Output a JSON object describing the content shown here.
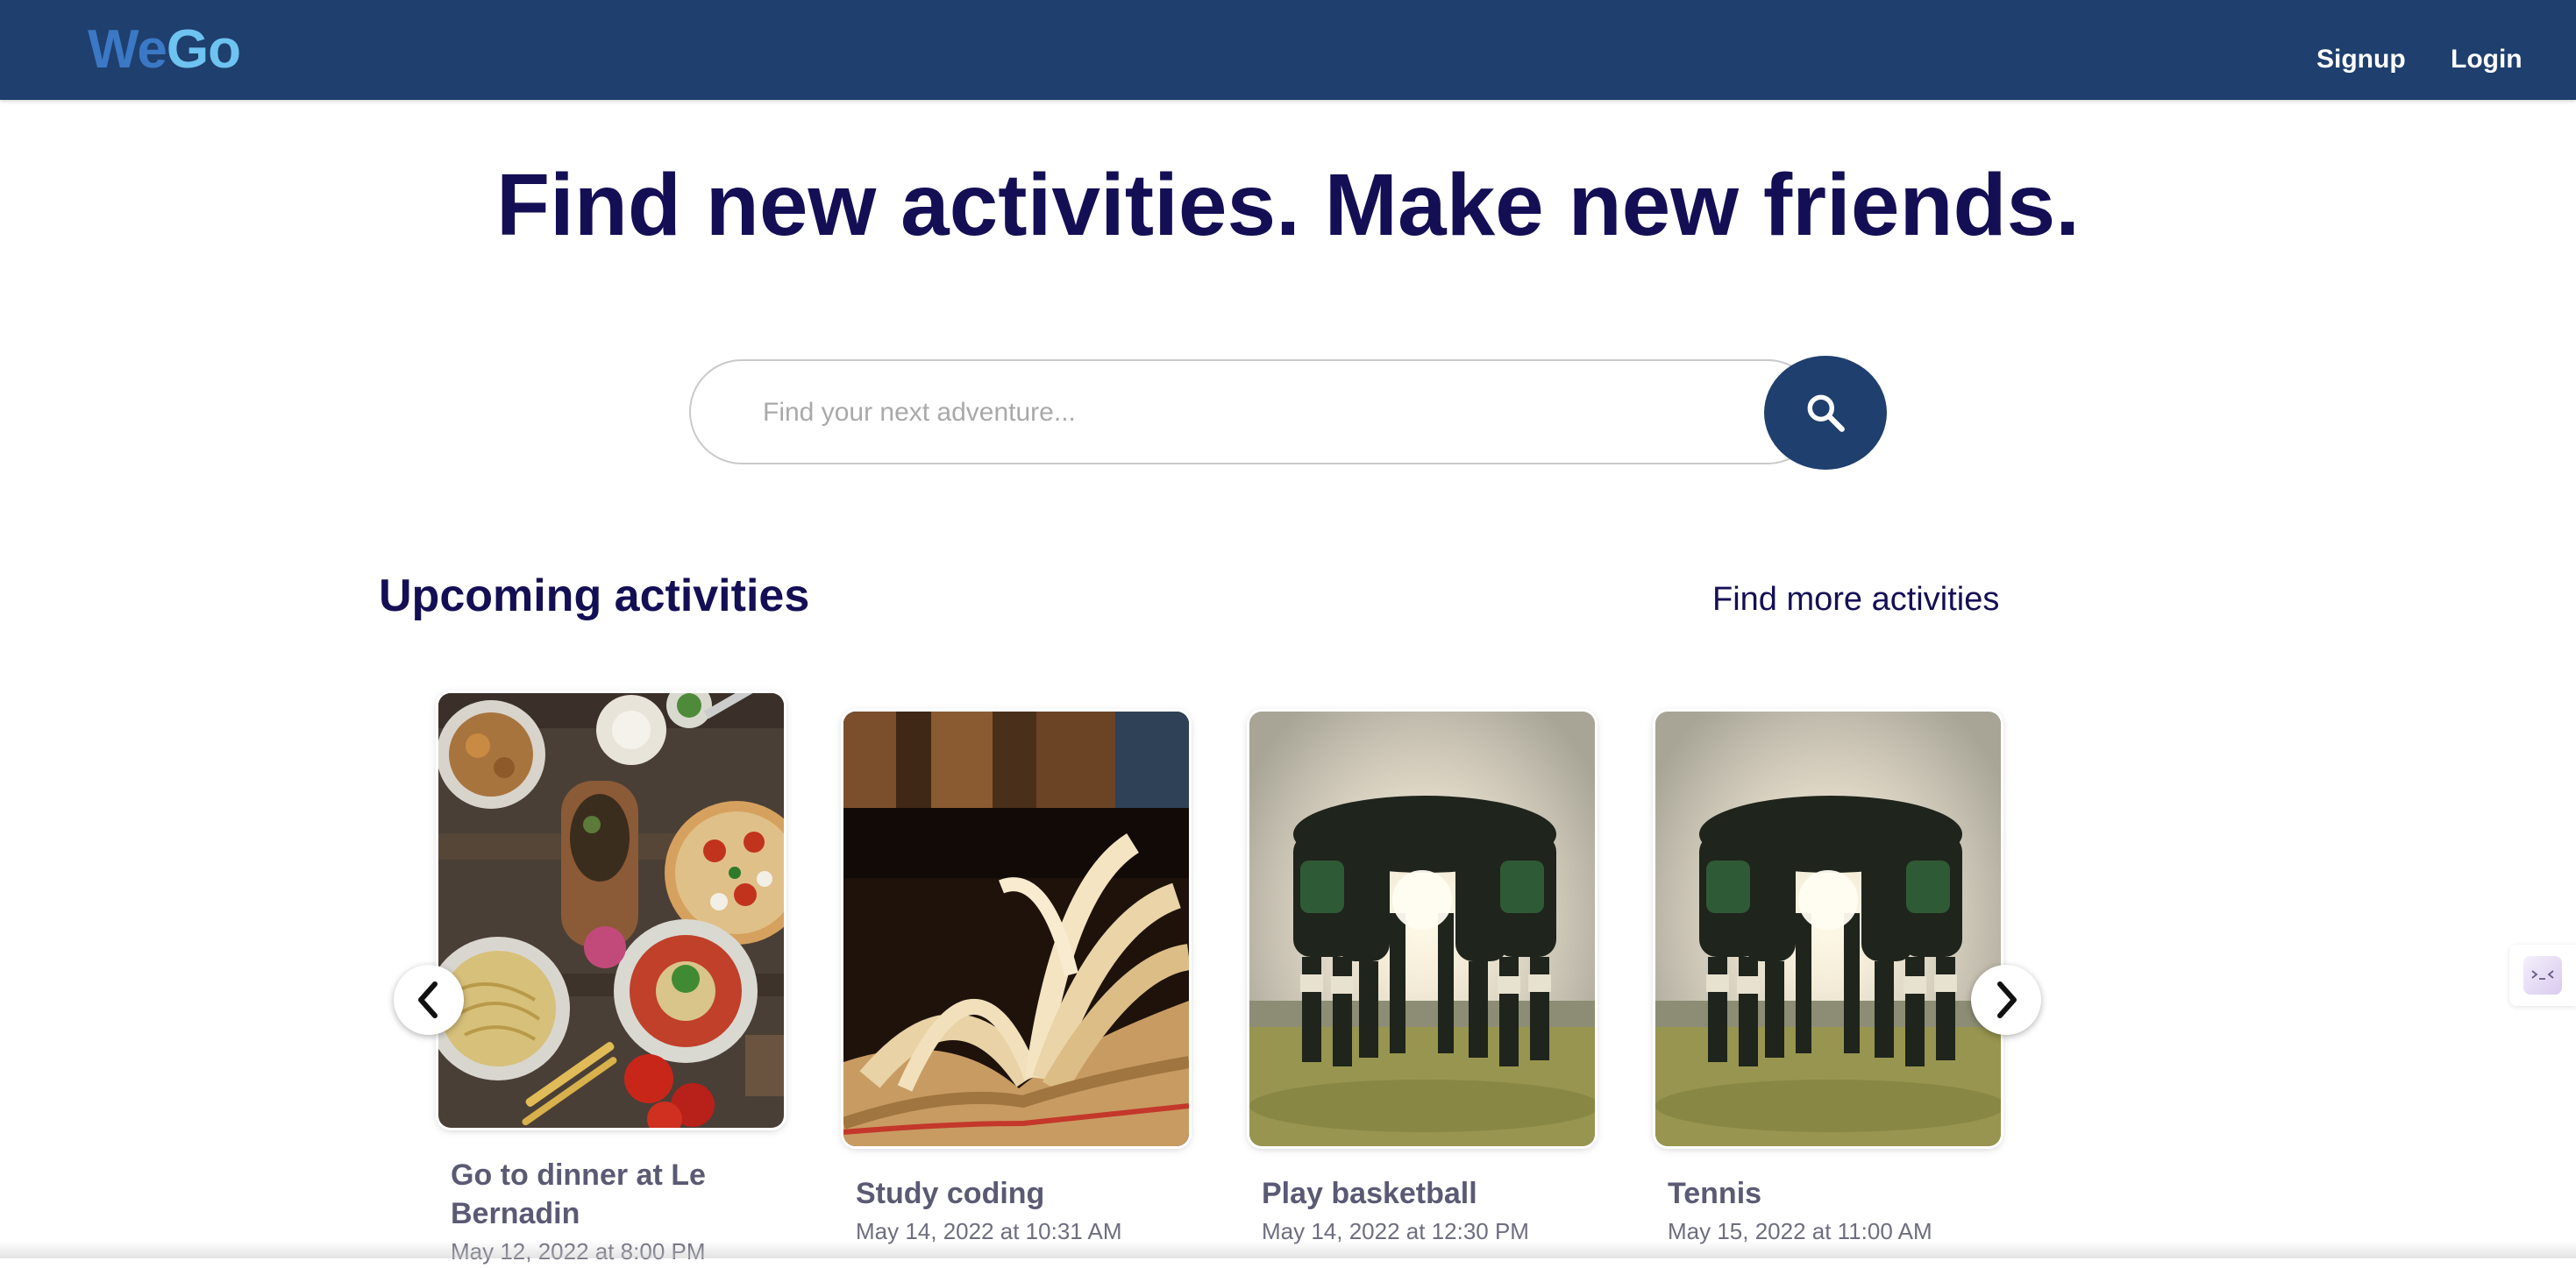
{
  "navbar": {
    "logo_part1": "We",
    "logo_part2": "Go",
    "signup_label": "Signup",
    "login_label": "Login",
    "background_color": "#1f3f6e"
  },
  "hero": {
    "title": "Find new activities. Make new friends."
  },
  "search": {
    "placeholder": "Find your next adventure...",
    "value": "",
    "button_icon": "search-icon"
  },
  "upcoming": {
    "title": "Upcoming activities",
    "more_link": "Find more activities",
    "prev_icon": "chevron-left-icon",
    "next_icon": "chevron-right-icon",
    "cards": [
      {
        "title": "Go to dinner at Le Bernadin",
        "date": "May 12, 2022 at 8:00 PM",
        "image": "food-spread-image"
      },
      {
        "title": "Study coding",
        "date": "May 14, 2022 at 10:31 AM",
        "image": "open-book-image"
      },
      {
        "title": "Play basketball",
        "date": "May 14, 2022 at 12:30 PM",
        "image": "team-huddle-image"
      },
      {
        "title": "Tennis",
        "date": "May 15, 2022 at 11:00 AM",
        "image": "team-huddle-image"
      }
    ]
  },
  "colors": {
    "brand_dark": "#1f3f6e",
    "heading": "#140f55",
    "logo_blue": "#3b78c5",
    "logo_light_blue": "#6ec3f0"
  }
}
